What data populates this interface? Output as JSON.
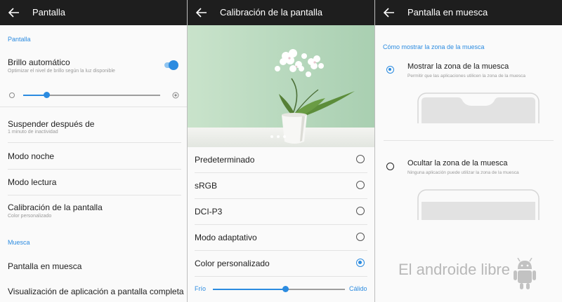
{
  "panel_display": {
    "title": "Pantalla",
    "section_display": "Pantalla",
    "auto_brightness": {
      "title": "Brillo automático",
      "subtitle": "Optimizar el nivel de brillo según la luz disponible",
      "enabled": true
    },
    "brightness_level": 0.17,
    "items": [
      {
        "title": "Suspender después de",
        "subtitle": "1 minuto de inactividad"
      },
      {
        "title": "Modo noche",
        "subtitle": ""
      },
      {
        "title": "Modo lectura",
        "subtitle": ""
      },
      {
        "title": "Calibración de la pantalla",
        "subtitle": "Color personalizado"
      }
    ],
    "section_notch": "Muesca",
    "notch_items": [
      {
        "title": "Pantalla en muesca"
      },
      {
        "title": "Visualización de aplicación a pantalla completa"
      }
    ]
  },
  "panel_calibration": {
    "title": "Calibración de la pantalla",
    "preview_page_count": 3,
    "options": [
      {
        "label": "Predeterminado",
        "selected": false
      },
      {
        "label": "sRGB",
        "selected": false
      },
      {
        "label": "DCI-P3",
        "selected": false
      },
      {
        "label": "Modo adaptativo",
        "selected": false
      },
      {
        "label": "Color personalizado",
        "selected": true
      }
    ],
    "temperature": {
      "cold_label": "Frío",
      "warm_label": "Cálido",
      "level": 0.55
    }
  },
  "panel_notch": {
    "title": "Pantalla en muesca",
    "section": "Cómo mostrar la zona de la muesca",
    "options": [
      {
        "title": "Mostrar la zona de la muesca",
        "subtitle": "Permitir que las aplicaciones utilicen la zona de la muesca",
        "selected": true
      },
      {
        "title": "Ocultar la zona de la muesca",
        "subtitle": "Ninguna aplicación puede utilizar la zona de la muesca",
        "selected": false
      }
    ]
  },
  "watermark": {
    "text": "El androide libre"
  },
  "colors": {
    "accent": "#2b8be0",
    "topbar": "#1e1e1e",
    "background": "#fafafa",
    "divider": "#e3e3e3",
    "photo_wall": "#b9d9bf"
  },
  "icons": {
    "back": "arrow-left-icon",
    "brightness_low": "sun-small-icon",
    "brightness_high": "sun-large-icon",
    "watermark_logo": "android-robot-icon"
  }
}
